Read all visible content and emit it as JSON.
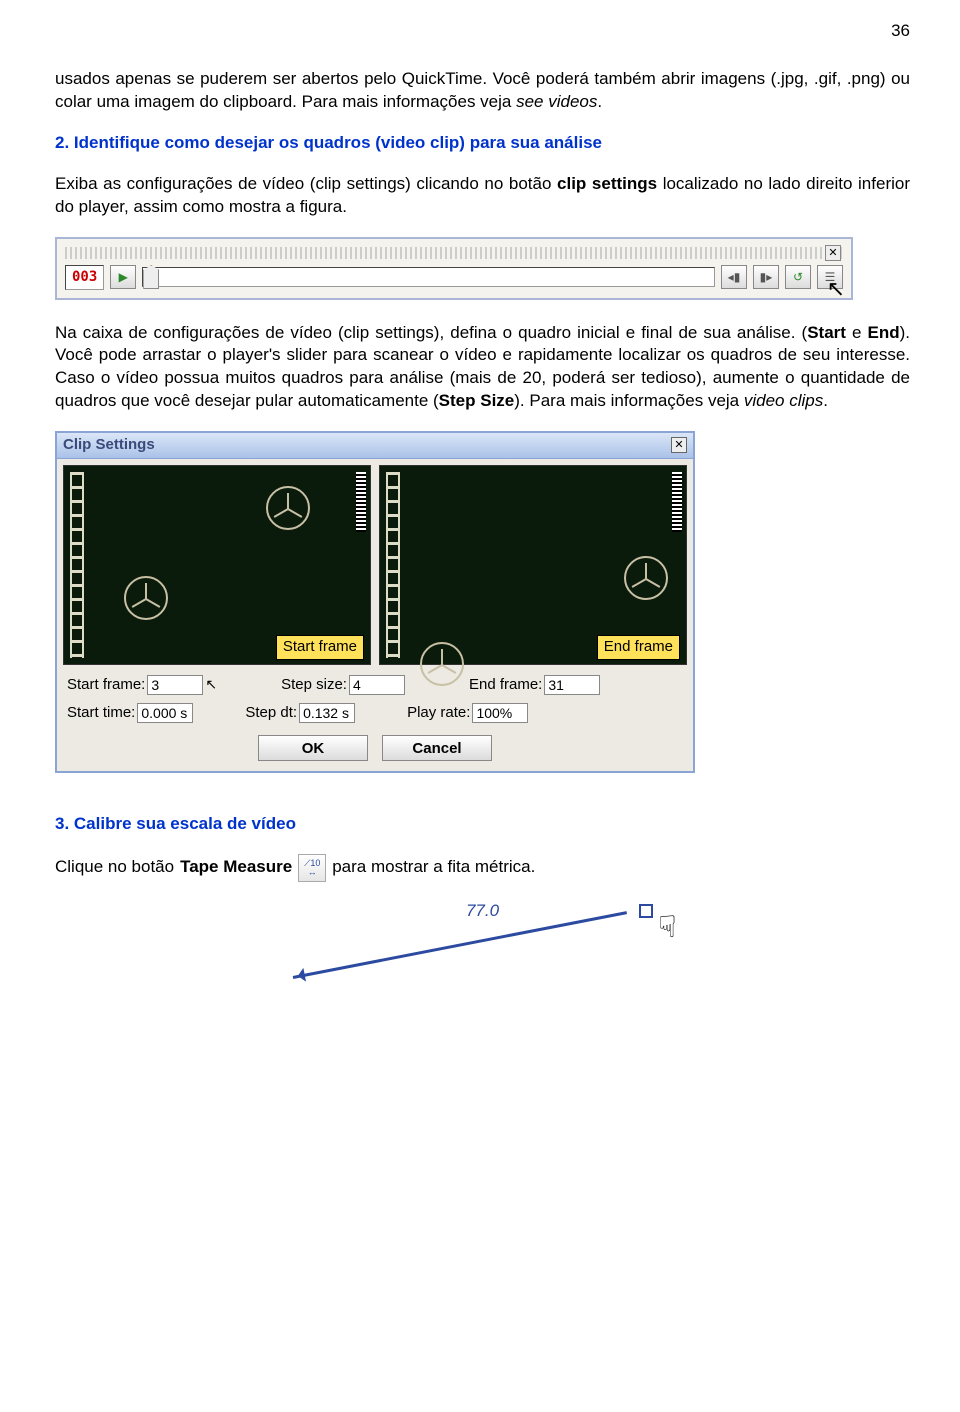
{
  "page_number": "36",
  "para1": {
    "t1": "usados apenas se puderem ser abertos pelo QuickTime. Você poderá também abrir imagens (.jpg, .gif, .png) ou colar uma imagem do clipboard. Para mais informações veja ",
    "see_videos": "see videos",
    "t2": "."
  },
  "step2": {
    "num": "2. ",
    "title": "Identifique como desejar os quadros (video clip) para sua análise"
  },
  "para2": {
    "t1": "Exiba as configurações de vídeo (clip settings) clicando no botão ",
    "bold": "clip settings",
    "t2": " localizado no lado direito inferior do player, assim como mostra a figura."
  },
  "player": {
    "counter": "003"
  },
  "para3": {
    "t1": "Na caixa de configurações de vídeo (clip settings), defina o quadro inicial e final de sua análise. (",
    "start": "Start",
    "e": " e ",
    "end": "End",
    "t2": "). Você pode arrastar o player's slider para scanear o vídeo e rapidamente localizar os quadros de seu interesse. Caso o vídeo possua muitos quadros para análise (mais de 20, poderá ser tedioso), aumente o quantidade de quadros que você desejar pular automaticamente (",
    "step": "Step Size",
    "t3": "). Para mais informações veja ",
    "vc": "video clips",
    "t4": "."
  },
  "dialog": {
    "title": "Clip Settings",
    "start_tag": "Start frame",
    "end_tag": "End frame",
    "labels": {
      "start_frame": "Start frame:",
      "step_size": "Step size:",
      "end_frame": "End frame:",
      "start_time": "Start time:",
      "step_dt": "Step dt:",
      "play_rate": "Play rate:"
    },
    "values": {
      "start_frame": "3",
      "step_size": "4",
      "end_frame": "31",
      "start_time": "0.000 s",
      "step_dt": "0.132 s",
      "play_rate": "100%"
    },
    "ok": "OK",
    "cancel": "Cancel"
  },
  "step3": {
    "num": "3. ",
    "title": "Calibre sua escala de vídeo"
  },
  "tape": {
    "t1": "Clique no botão ",
    "bold": "Tape Measure",
    "t2": " para mostrar a fita métrica.",
    "value": "77.0"
  }
}
